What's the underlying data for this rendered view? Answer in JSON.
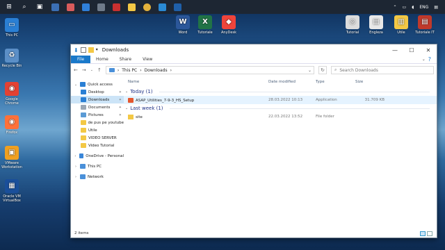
{
  "taskbar": {
    "tray": {
      "language": "ENG"
    }
  },
  "desktop": {
    "icons": [
      {
        "label": "This PC",
        "color": "#2a7fd4",
        "glyph": "▭"
      },
      {
        "label": "Recycle Bin",
        "color": "#5b8fc7",
        "glyph": "♻"
      },
      {
        "label": "Google Chrome",
        "color": "#e34133",
        "glyph": "◉"
      },
      {
        "label": "Firefox",
        "color": "#ff7139",
        "glyph": "◉"
      },
      {
        "label": "VMware Workstation",
        "color": "#f0a020",
        "glyph": "▣"
      },
      {
        "label": "Oracle VM VirtualBox",
        "color": "#1a4f9a",
        "glyph": "▦"
      },
      {
        "label": "Word",
        "color": "#2b579a",
        "glyph": "W"
      },
      {
        "label": "Tutoriale",
        "color": "#217346",
        "glyph": "X"
      },
      {
        "label": "AnyDesk",
        "color": "#ef443b",
        "glyph": "◆"
      },
      {
        "label": "Tutorial",
        "color": "#dcdcdc",
        "glyph": "◎"
      },
      {
        "label": "Engleza",
        "color": "#e8e8e8",
        "glyph": "▤"
      },
      {
        "label": "Utile",
        "color": "#f3c845",
        "glyph": "▥"
      },
      {
        "label": "Tutoriale IT",
        "color": "#c0392b",
        "glyph": "▤"
      }
    ]
  },
  "window": {
    "title": "Downloads",
    "ribbon": {
      "file": "File",
      "home": "Home",
      "share": "Share",
      "view": "View",
      "help": "?"
    },
    "address": {
      "this_pc": "This PC",
      "downloads": "Downloads"
    },
    "search": {
      "placeholder": "Search Downloads"
    },
    "nav": [
      {
        "label": "Quick access",
        "level": 0,
        "arrow": "⌄",
        "icon": "#2a7fd4"
      },
      {
        "label": "Desktop",
        "level": 1,
        "icon": "#2a7fd4",
        "pin": true
      },
      {
        "label": "Downloads",
        "level": 1,
        "icon": "#2a7fd4",
        "pin": true,
        "selected": true
      },
      {
        "label": "Documents",
        "level": 1,
        "icon": "#9aa7b5",
        "pin": true
      },
      {
        "label": "Pictures",
        "level": 1,
        "icon": "#5b9bd5",
        "pin": true
      },
      {
        "label": "de pus pe youtube",
        "level": 1,
        "icon": "#f3c845"
      },
      {
        "label": "Utile",
        "level": 1,
        "icon": "#f3c845"
      },
      {
        "label": "VIDEO SERVER",
        "level": 1,
        "icon": "#f3c845"
      },
      {
        "label": "Video Tutorial",
        "level": 1,
        "icon": "#f3c845"
      },
      {
        "label": "OneDrive - Personal",
        "level": 0,
        "arrow": "›",
        "icon": "#3a86d8",
        "gap": true
      },
      {
        "label": "This PC",
        "level": 0,
        "arrow": "›",
        "icon": "#4a90d9",
        "gap": true
      },
      {
        "label": "Network",
        "level": 0,
        "arrow": "›",
        "icon": "#4a90d9",
        "gap": true
      }
    ],
    "columns": {
      "name": "Name",
      "date": "Date modified",
      "type": "Type",
      "size": "Size"
    },
    "groups": {
      "today": {
        "label": "Today (1)"
      },
      "last_week": {
        "label": "Last week (1)"
      }
    },
    "files": {
      "setup": {
        "name": "ASAP_Utilities_7-9-3_HS_Setup",
        "date": "28.03.2022 10:13",
        "type": "Application",
        "size": "31.709 KB"
      },
      "site": {
        "name": "site",
        "date": "22.03.2022 13:52",
        "type": "File folder",
        "size": ""
      }
    },
    "status": {
      "items": "2 items"
    }
  }
}
